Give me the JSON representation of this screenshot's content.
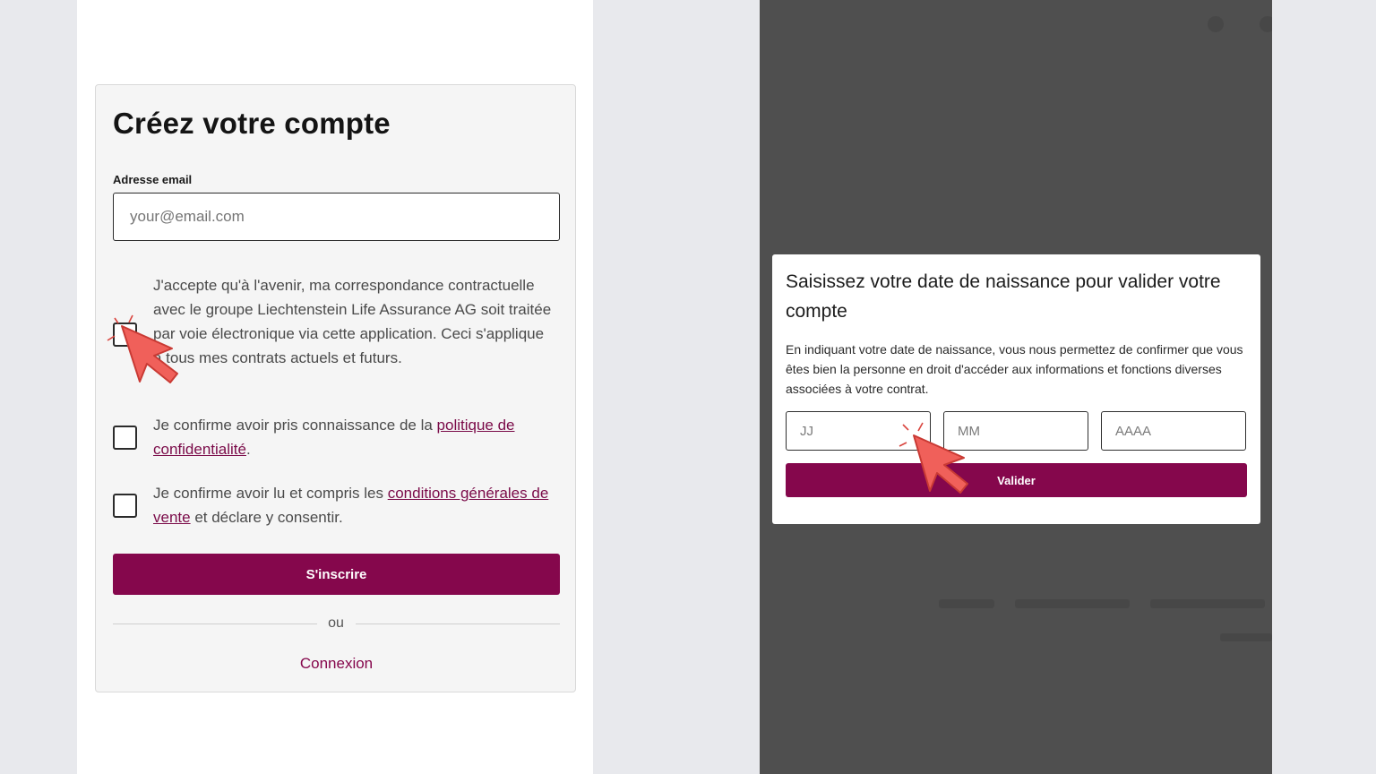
{
  "signup": {
    "title": "Créez votre compte",
    "email_label": "Adresse email",
    "email_placeholder": "your@email.com",
    "consent_1": "J'accepte qu'à l'avenir, ma correspondance contractuelle avec le groupe Liechtenstein Life Assurance AG soit traitée par voie électronique via cette application. Ceci s'applique à tous mes contrats actuels et futurs.",
    "consent_2_prefix": "Je confirme avoir pris connaissance de la ",
    "consent_2_link": "politique de confidentialité",
    "consent_2_suffix": ".",
    "consent_3_prefix": "Je confirme avoir lu et compris les ",
    "consent_3_link": "conditions générales de vente",
    "consent_3_suffix": " et déclare y consentir.",
    "submit_label": "S'inscrire",
    "divider_label": "ou",
    "login_label": "Connexion"
  },
  "birthdate_modal": {
    "title": "Saisissez votre date de naissance pour valider votre compte",
    "description": "En indiquant votre date de naissance, vous nous permettez de confirmer que vous êtes bien la personne en droit d'accéder aux informations et fonctions diverses associées à votre contrat.",
    "day_placeholder": "JJ",
    "month_placeholder": "MM",
    "year_placeholder": "AAAA",
    "validate_label": "Valider"
  },
  "colors": {
    "brand": "#85074c",
    "overlay": "#4f4f4f",
    "cursor": "#f0605a"
  },
  "icons": [
    "cursor-arrow-icon",
    "click-burst-icon"
  ]
}
